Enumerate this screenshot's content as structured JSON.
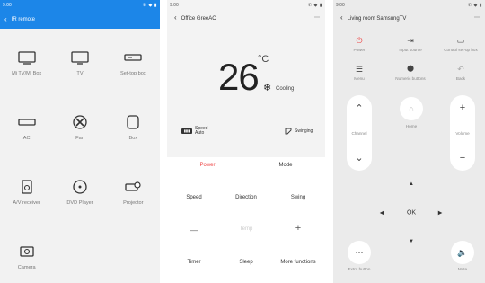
{
  "panel1": {
    "status_time": "9:00",
    "status_icons": "✆ ◆ ▮",
    "back_glyph": "‹",
    "title": "IR remote",
    "devices": [
      {
        "label": "Mi TV/Mi Box",
        "icon": "tv-box-icon"
      },
      {
        "label": "TV",
        "icon": "tv-icon"
      },
      {
        "label": "Set-top box",
        "icon": "set-top-box-icon"
      },
      {
        "label": "AC",
        "icon": "ac-icon"
      },
      {
        "label": "Fan",
        "icon": "fan-icon"
      },
      {
        "label": "Box",
        "icon": "box-icon"
      },
      {
        "label": "A/V receiver",
        "icon": "av-receiver-icon"
      },
      {
        "label": "DVD Player",
        "icon": "dvd-player-icon"
      },
      {
        "label": "Projector",
        "icon": "projector-icon"
      },
      {
        "label": "Camera",
        "icon": "camera-icon"
      }
    ],
    "accent": "#1c86e8"
  },
  "panel2": {
    "status_time": "9:00",
    "status_icons": "✆ ◆ ▮",
    "back_glyph": "‹",
    "title": "Office GreeAC",
    "more": "⋯",
    "temperature": "26",
    "unit": "°C",
    "mode_icon": "❄",
    "mode": "Cooling",
    "speed_badge": "▮▮▮",
    "speed_label": "Speed",
    "speed_value": "Auto",
    "swing_label": "Swinging",
    "buttons": {
      "power": "Power",
      "mode": "Mode",
      "speed": "Speed",
      "direction": "Direction",
      "swing": "Swing",
      "minus": "—",
      "temp": "Temp",
      "plus": "+",
      "timer": "Timer",
      "sleep": "Sleep",
      "more_functions": "More functions"
    },
    "power_color": "#e44444"
  },
  "panel3": {
    "status_time": "9:00",
    "status_icons": "✆ ◆ ▮",
    "back_glyph": "‹",
    "title": "Living room SamsungTV",
    "more": "⋯",
    "top_buttons": {
      "power": "Power",
      "input": "Input source",
      "control": "Control set-up box",
      "menu": "Menu",
      "numeric": "Numeric buttons",
      "back": "Back"
    },
    "glyphs": {
      "power": "⏻",
      "input": "⇥",
      "control": "▭",
      "menu": "☰",
      "numeric": "⬤",
      "back": "↶",
      "home": "⌂",
      "up": "⌃",
      "down": "⌄",
      "plus": "+",
      "minus": "−",
      "dpad_up": "▲",
      "dpad_down": "▼",
      "dpad_left": "◀",
      "dpad_right": "▶",
      "extra": "⋯",
      "mute": "🔈"
    },
    "channel_label": "Channel",
    "home_label": "Home",
    "volume_label": "Volume",
    "ok": "OK",
    "extra_label": "Extra button",
    "mute_label": "Mute"
  }
}
